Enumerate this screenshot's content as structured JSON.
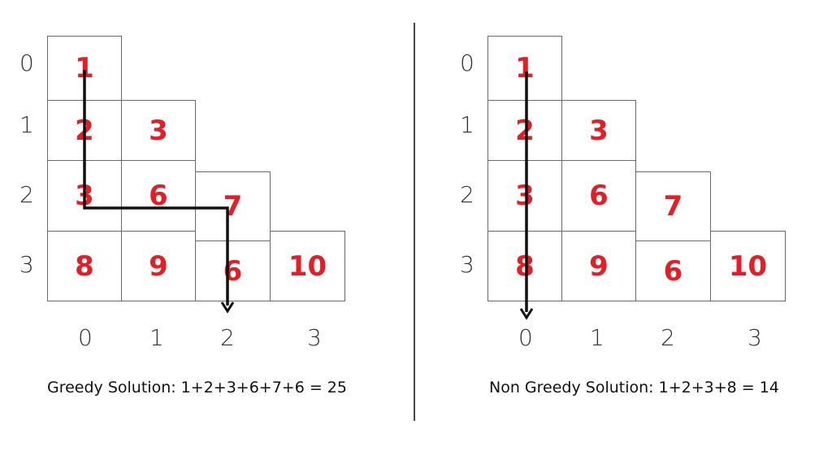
{
  "accent_color": "#e21e26",
  "left_panel": {
    "rows": [
      [
        "1"
      ],
      [
        "2",
        "3"
      ],
      [
        "3",
        "6",
        "7"
      ],
      [
        "8",
        "9",
        "6",
        "10"
      ]
    ],
    "row_labels": [
      "0",
      "1",
      "2",
      "3"
    ],
    "col_labels": [
      "0",
      "1",
      "2",
      "3"
    ],
    "caption": "Greedy Solution: 1+2+3+6+7+6 = 25"
  },
  "right_panel": {
    "rows": [
      [
        "1"
      ],
      [
        "2",
        "3"
      ],
      [
        "3",
        "6",
        "7"
      ],
      [
        "8",
        "9",
        "6",
        "10"
      ]
    ],
    "row_labels": [
      "0",
      "1",
      "2",
      "3"
    ],
    "col_labels": [
      "0",
      "1",
      "2",
      "3"
    ],
    "caption": "Non Greedy Solution: 1+2+3+8 = 14"
  }
}
